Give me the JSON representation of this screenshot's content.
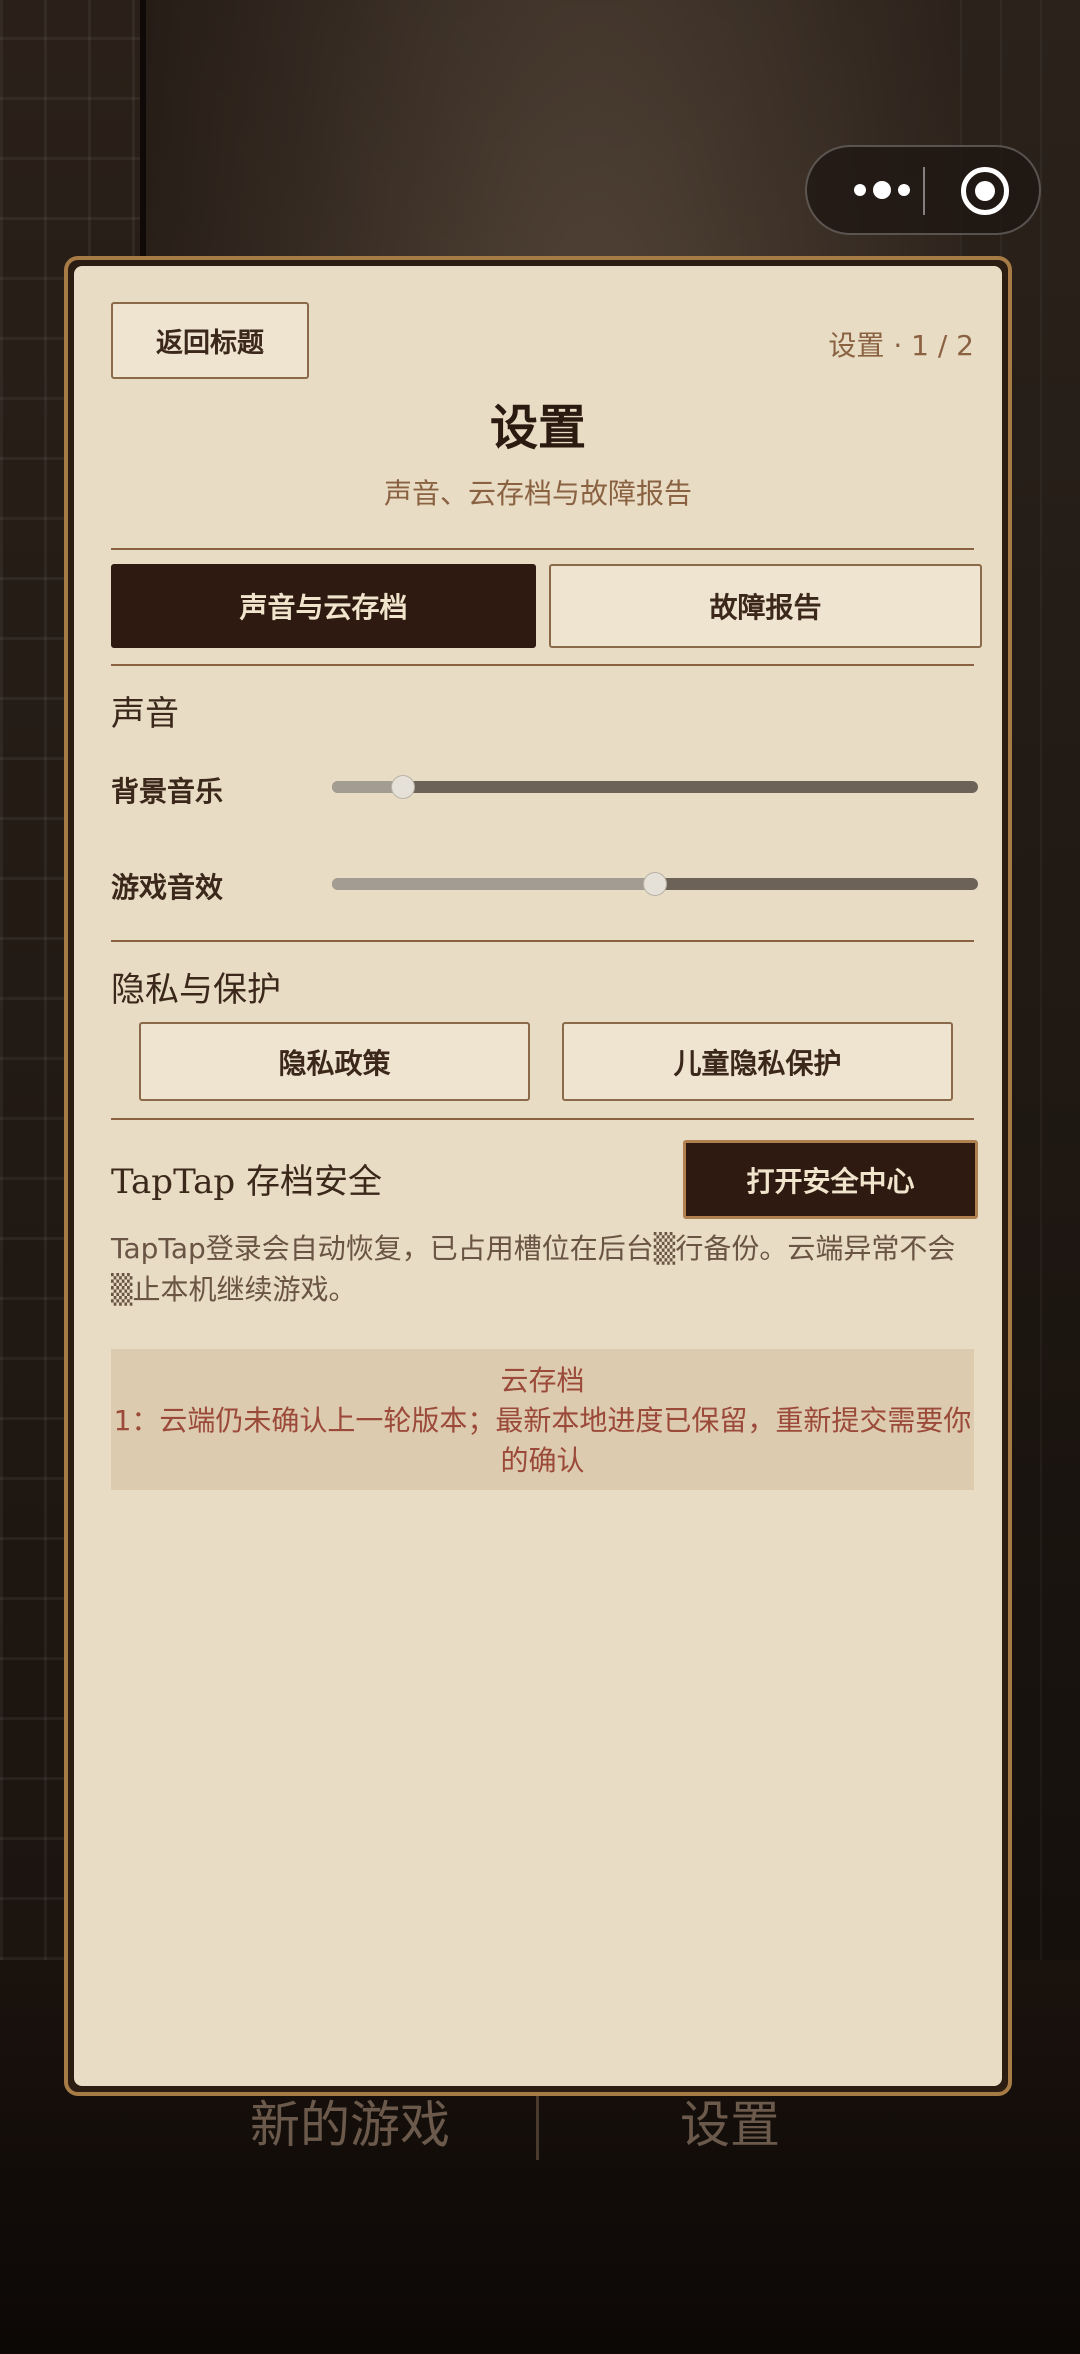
{
  "background": {
    "menu_left": "新的游戏",
    "menu_right": "设置"
  },
  "capsule": {
    "more_icon": "more-dots-icon",
    "close_icon": "target-circle-icon"
  },
  "modal": {
    "back_label": "返回标题",
    "page_indicator": "设置 · 1 / 2",
    "title": "设置",
    "subtitle": "声音、云存档与故障报告",
    "tabs": [
      {
        "label": "声音与云存档",
        "active": true
      },
      {
        "label": "故障报告",
        "active": false
      }
    ],
    "sound": {
      "heading": "声音",
      "sliders": [
        {
          "label": "背景音乐",
          "value": 0.11
        },
        {
          "label": "游戏音效",
          "value": 0.5
        }
      ]
    },
    "privacy": {
      "heading": "隐私与保护",
      "buttons": [
        "隐私政策",
        "儿童隐私保护"
      ]
    },
    "taptap": {
      "heading": "TapTap 存档安全",
      "button": "打开安全中心",
      "note": "TapTap登录会自动恢复，已占用槽位在后台▒行备份。云端异常不会▒止本机继续游戏。"
    },
    "cloud_alert": {
      "title": "云存档",
      "message": "1：云端仍未确认上一轮版本；最新本地进度已保留，重新提交需要你的确认"
    }
  },
  "colors": {
    "accent_dark": "#2e1a10",
    "panel_bg": "#e8dcc4",
    "frame_gold": "#a77b45",
    "alert_text": "#9b4a3a"
  }
}
